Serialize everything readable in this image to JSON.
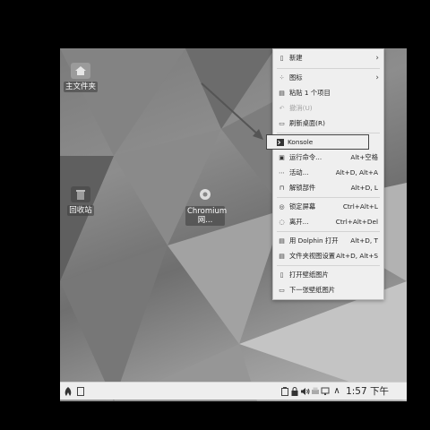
{
  "desktop": {
    "icons": [
      {
        "label": "主文件夹",
        "icon": "home-folder-icon"
      },
      {
        "label": "回收站",
        "icon": "trash-icon"
      },
      {
        "label": "Chromium 网...",
        "icon": "chromium-icon"
      }
    ]
  },
  "menu": {
    "items": [
      {
        "label": "新建",
        "shortcut": "",
        "icon": "new-file-icon",
        "submenu": true,
        "disabled": false
      },
      {
        "label": "图标",
        "shortcut": "",
        "icon": "icons-grid-icon",
        "submenu": true,
        "disabled": false
      },
      {
        "label": "粘贴 1 个项目",
        "shortcut": "",
        "icon": "paste-icon",
        "submenu": false,
        "disabled": false
      },
      {
        "label": "撤消(U)",
        "shortcut": "",
        "icon": "undo-icon",
        "submenu": false,
        "disabled": true
      },
      {
        "label": "刷新桌面(R)",
        "shortcut": "",
        "icon": "refresh-icon",
        "submenu": false,
        "disabled": false
      },
      {
        "label": "Konsole",
        "shortcut": "",
        "icon": "terminal-icon",
        "submenu": false,
        "disabled": false,
        "highlighted": true
      },
      {
        "label": "运行命令...",
        "shortcut": "Alt+空格",
        "icon": "run-command-icon",
        "submenu": false,
        "disabled": false
      },
      {
        "label": "活动...",
        "shortcut": "Alt+D, Alt+A",
        "icon": "activities-icon",
        "submenu": false,
        "disabled": false
      },
      {
        "label": "解锁部件",
        "shortcut": "Alt+D, L",
        "icon": "unlock-icon",
        "submenu": false,
        "disabled": false
      },
      {
        "label": "锁定屏幕",
        "shortcut": "Ctrl+Alt+L",
        "icon": "lock-screen-icon",
        "submenu": false,
        "disabled": false
      },
      {
        "label": "离开...",
        "shortcut": "Ctrl+Alt+Del",
        "icon": "leave-icon",
        "submenu": false,
        "disabled": false
      },
      {
        "label": "用 Dolphin 打开",
        "shortcut": "Alt+D, T",
        "icon": "dolphin-icon",
        "submenu": false,
        "disabled": false
      },
      {
        "label": "文件夹视图设置",
        "shortcut": "Alt+D, Alt+S",
        "icon": "folder-settings-icon",
        "submenu": false,
        "disabled": false
      },
      {
        "label": "打开壁纸图片",
        "shortcut": "",
        "icon": "open-wallpaper-icon",
        "submenu": false,
        "disabled": false
      },
      {
        "label": "下一张壁纸图片",
        "shortcut": "",
        "icon": "next-wallpaper-icon",
        "submenu": false,
        "disabled": false
      }
    ],
    "submenu_arrow": "›"
  },
  "taskbar": {
    "time": "1:57 下午",
    "tray_expand": "∧"
  }
}
